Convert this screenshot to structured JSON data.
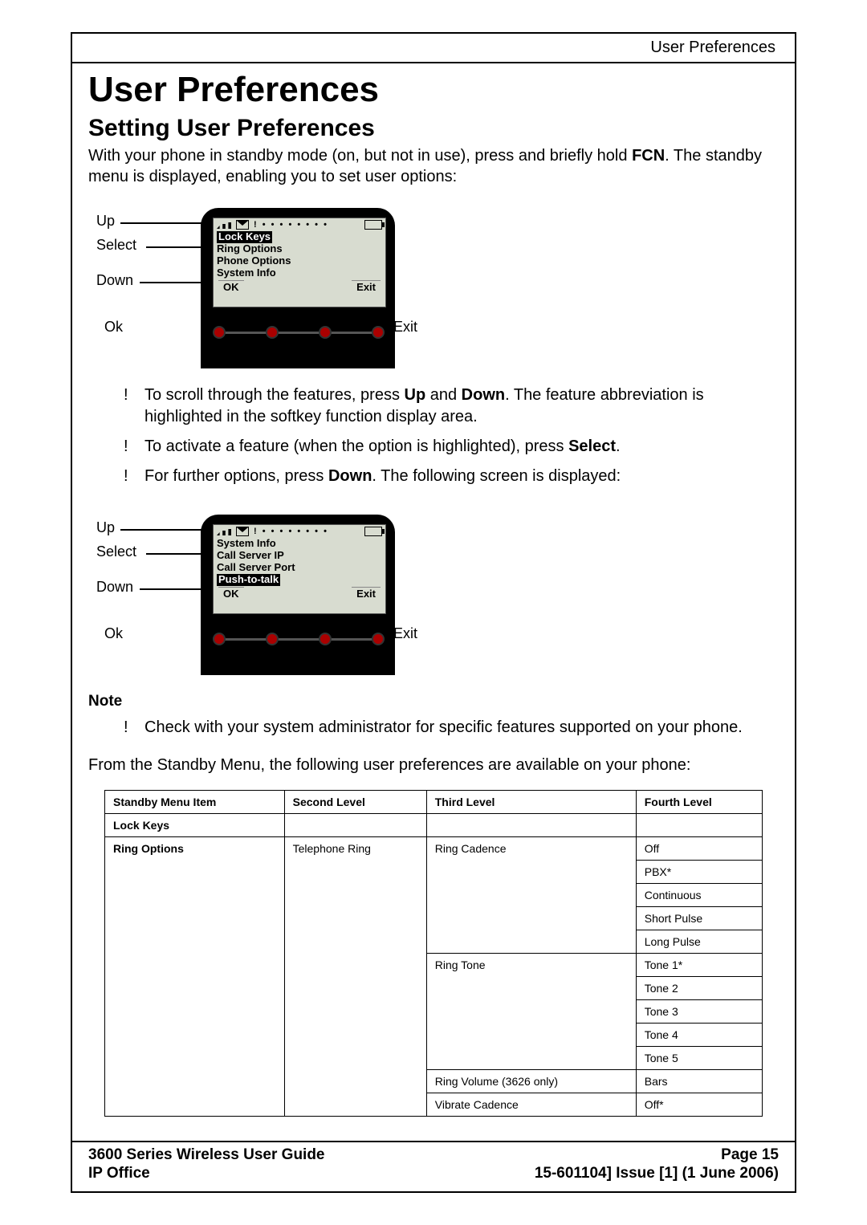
{
  "header": {
    "running": "User Preferences"
  },
  "h1": "User Preferences",
  "h2": "Setting User Preferences",
  "intro_a": "With your phone in standby mode (on, but not in use), press and briefly hold ",
  "intro_fcn": "FCN",
  "intro_b": ". The standby menu is displayed, enabling you to set user options:",
  "fig1": {
    "labels": {
      "up": "Up",
      "select": "Select",
      "down": "Down",
      "ok": "Ok",
      "exit": "Exit"
    },
    "dots": "! • • • • • • • •",
    "menu": [
      "Lock Keys",
      "Ring Options",
      "Phone Options",
      "System Info"
    ],
    "highlight_index": 0,
    "sk_left": "OK",
    "sk_right": "Exit"
  },
  "bullets1": [
    {
      "pre": "To scroll through the features, press ",
      "b1": "Up",
      "mid": " and ",
      "b2": "Down",
      "post": ". The feature abbreviation is highlighted in the softkey function display area."
    },
    {
      "pre": "To activate a feature (when the option is highlighted), press ",
      "b1": "Select",
      "post": "."
    },
    {
      "pre": "For further options, press ",
      "b1": "Down",
      "post": ". The following screen is displayed:"
    }
  ],
  "fig2": {
    "labels": {
      "up": "Up",
      "select": "Select",
      "down": "Down",
      "ok": "Ok",
      "exit": "Exit"
    },
    "dots": "! • • • • • • • •",
    "menu": [
      "System Info",
      "Call Server IP",
      "Call Server Port",
      "Push-to-talk"
    ],
    "highlight_index": 3,
    "sk_left": "OK",
    "sk_right": "Exit"
  },
  "note_label": "Note",
  "note_bullet": "Check with your system administrator for specific features supported on your phone.",
  "after_note": "From the Standby Menu, the following user preferences are available on your phone:",
  "table": {
    "headers": [
      "Standby Menu Item",
      "Second Level",
      "Third Level",
      "Fourth Level"
    ],
    "rows": [
      [
        "Lock Keys",
        "",
        "",
        ""
      ],
      [
        "Ring Options",
        "Telephone Ring",
        "Ring Cadence",
        "Off"
      ],
      [
        "",
        "",
        "",
        "PBX*"
      ],
      [
        "",
        "",
        "",
        "Continuous"
      ],
      [
        "",
        "",
        "",
        "Short Pulse"
      ],
      [
        "",
        "",
        "",
        "Long Pulse"
      ],
      [
        "",
        "",
        "Ring Tone",
        "Tone 1*"
      ],
      [
        "",
        "",
        "",
        "Tone 2"
      ],
      [
        "",
        "",
        "",
        "Tone 3"
      ],
      [
        "",
        "",
        "",
        "Tone 4"
      ],
      [
        "",
        "",
        "",
        "Tone 5"
      ],
      [
        "",
        "",
        "Ring Volume (3626 only)",
        "Bars"
      ],
      [
        "",
        "",
        "Vibrate Cadence",
        "Off*"
      ]
    ],
    "bold_col0": [
      0,
      1
    ]
  },
  "footer": {
    "l1_left": "3600 Series Wireless User Guide",
    "l1_right": "Page 15",
    "l2_left": "IP Office",
    "l2_right": "15-601104] Issue [1] (1 June 2006)"
  }
}
